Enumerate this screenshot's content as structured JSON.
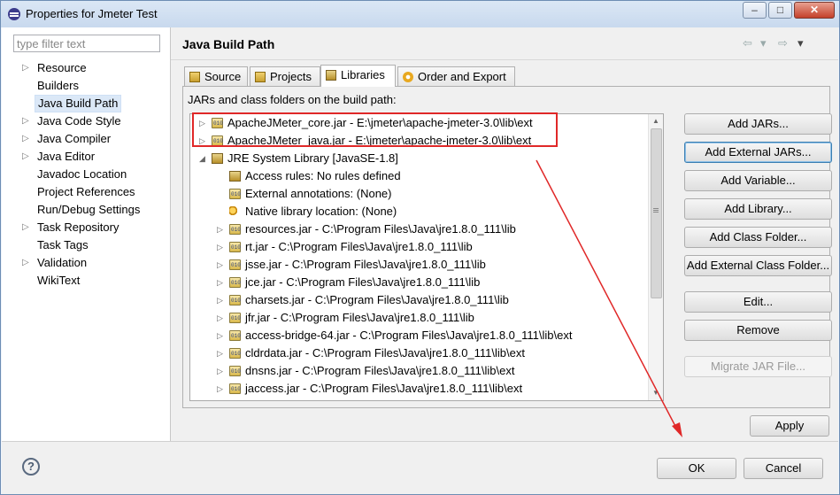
{
  "window": {
    "title": "Properties for Jmeter Test",
    "minimize": "–",
    "maximize": "□",
    "close": "✕"
  },
  "left": {
    "filter_placeholder": "type filter text",
    "items": [
      {
        "label": "Resource",
        "expandable": true
      },
      {
        "label": "Builders",
        "expandable": false
      },
      {
        "label": "Java Build Path",
        "expandable": false,
        "selected": true
      },
      {
        "label": "Java Code Style",
        "expandable": true
      },
      {
        "label": "Java Compiler",
        "expandable": true
      },
      {
        "label": "Java Editor",
        "expandable": true
      },
      {
        "label": "Javadoc Location",
        "expandable": false
      },
      {
        "label": "Project References",
        "expandable": false
      },
      {
        "label": "Run/Debug Settings",
        "expandable": false
      },
      {
        "label": "Task Repository",
        "expandable": true
      },
      {
        "label": "Task Tags",
        "expandable": false
      },
      {
        "label": "Validation",
        "expandable": true
      },
      {
        "label": "WikiText",
        "expandable": false
      }
    ]
  },
  "page": {
    "title": "Java Build Path",
    "nav_back": "⇦",
    "nav_forward": "⇨",
    "nav_dropdown": "▾",
    "tabs": [
      {
        "label": "Source",
        "active": false
      },
      {
        "label": "Projects",
        "active": false
      },
      {
        "label": "Libraries",
        "active": true
      },
      {
        "label": "Order and Export",
        "active": false
      }
    ],
    "section_label": "JARs and class folders on the build path:"
  },
  "libraries": [
    {
      "text": "ApacheJMeter_core.jar - E:\\jmeter\\apache-jmeter-3.0\\lib\\ext",
      "level": 0,
      "icon": "jar-icon",
      "expand": "collapsed"
    },
    {
      "text": "ApacheJMeter_java.jar - E:\\jmeter\\apache-jmeter-3.0\\lib\\ext",
      "level": 0,
      "icon": "jar-icon",
      "expand": "collapsed"
    },
    {
      "text": "JRE System Library [JavaSE-1.8]",
      "level": 0,
      "icon": "library-icon",
      "expand": "expanded"
    },
    {
      "text": "Access rules: No rules defined",
      "level": 1,
      "icon": "access-rules-icon",
      "expand": "none"
    },
    {
      "text": "External annotations: (None)",
      "level": 1,
      "icon": "annotations-icon",
      "expand": "none"
    },
    {
      "text": "Native library location: (None)",
      "level": 1,
      "icon": "native-library-icon",
      "expand": "none"
    },
    {
      "text": "resources.jar - C:\\Program Files\\Java\\jre1.8.0_111\\lib",
      "level": 1,
      "icon": "jar-icon",
      "expand": "collapsed"
    },
    {
      "text": "rt.jar - C:\\Program Files\\Java\\jre1.8.0_111\\lib",
      "level": 1,
      "icon": "jar-icon",
      "expand": "collapsed"
    },
    {
      "text": "jsse.jar - C:\\Program Files\\Java\\jre1.8.0_111\\lib",
      "level": 1,
      "icon": "jar-icon",
      "expand": "collapsed"
    },
    {
      "text": "jce.jar - C:\\Program Files\\Java\\jre1.8.0_111\\lib",
      "level": 1,
      "icon": "jar-icon",
      "expand": "collapsed"
    },
    {
      "text": "charsets.jar - C:\\Program Files\\Java\\jre1.8.0_111\\lib",
      "level": 1,
      "icon": "jar-icon",
      "expand": "collapsed"
    },
    {
      "text": "jfr.jar - C:\\Program Files\\Java\\jre1.8.0_111\\lib",
      "level": 1,
      "icon": "jar-icon",
      "expand": "collapsed"
    },
    {
      "text": "access-bridge-64.jar - C:\\Program Files\\Java\\jre1.8.0_111\\lib\\ext",
      "level": 1,
      "icon": "jar-icon",
      "expand": "collapsed"
    },
    {
      "text": "cldrdata.jar - C:\\Program Files\\Java\\jre1.8.0_111\\lib\\ext",
      "level": 1,
      "icon": "jar-icon",
      "expand": "collapsed"
    },
    {
      "text": "dnsns.jar - C:\\Program Files\\Java\\jre1.8.0_111\\lib\\ext",
      "level": 1,
      "icon": "jar-icon",
      "expand": "collapsed"
    },
    {
      "text": "jaccess.jar - C:\\Program Files\\Java\\jre1.8.0_111\\lib\\ext",
      "level": 1,
      "icon": "jar-icon",
      "expand": "collapsed"
    }
  ],
  "buttons": {
    "add_jars": "Add JARs...",
    "add_external_jars": "Add External JARs...",
    "add_variable": "Add Variable...",
    "add_library": "Add Library...",
    "add_class_folder": "Add Class Folder...",
    "add_external_class_folder": "Add External Class Folder...",
    "edit": "Edit...",
    "remove": "Remove",
    "migrate_jar": "Migrate JAR File...",
    "apply": "Apply",
    "ok": "OK",
    "cancel": "Cancel"
  },
  "help_label": "?",
  "colors": {
    "annotation_red": "#e02828",
    "selection": "#dbe8f7"
  }
}
